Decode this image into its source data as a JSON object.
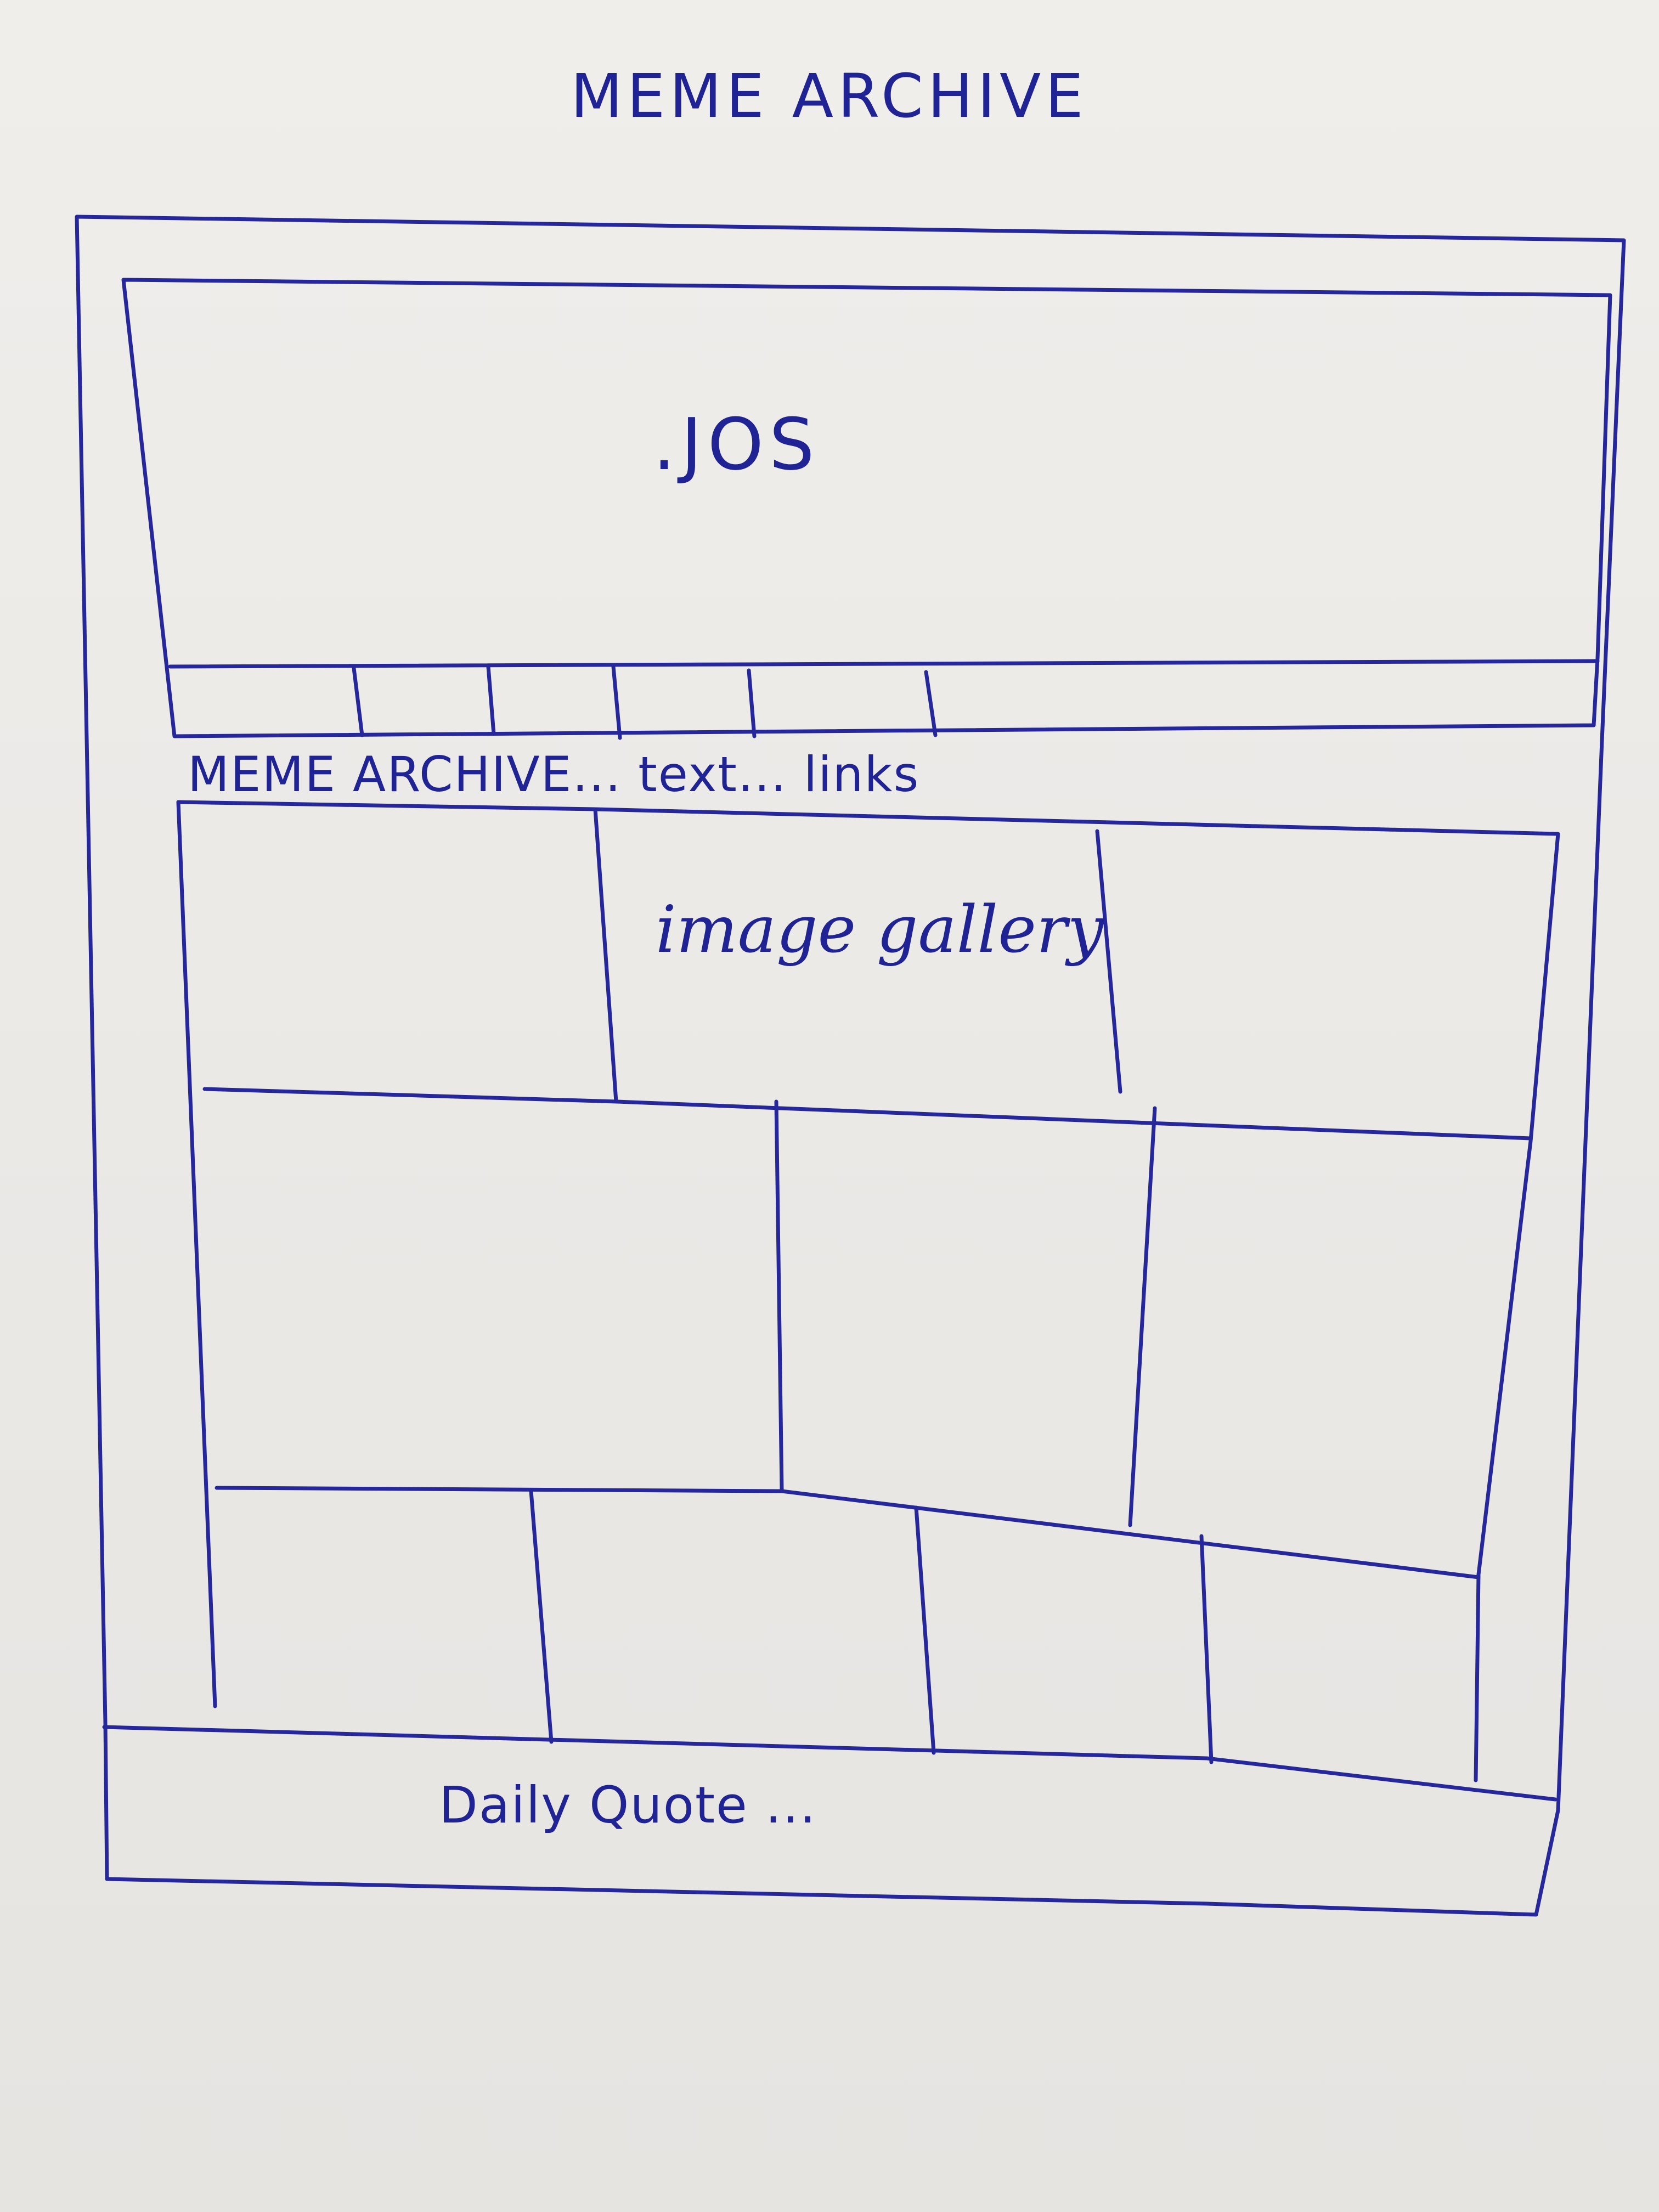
{
  "title": "MEME ARCHIVE",
  "hero": {
    "label": ".JOS"
  },
  "navbar": {
    "label": "MEME ARCHIVE... text... links"
  },
  "gallery": {
    "label": "image gallery"
  },
  "footer": {
    "label": "Daily Quote ..."
  },
  "colors": {
    "ink": "#25279a",
    "paper": "#ebe9e6"
  }
}
